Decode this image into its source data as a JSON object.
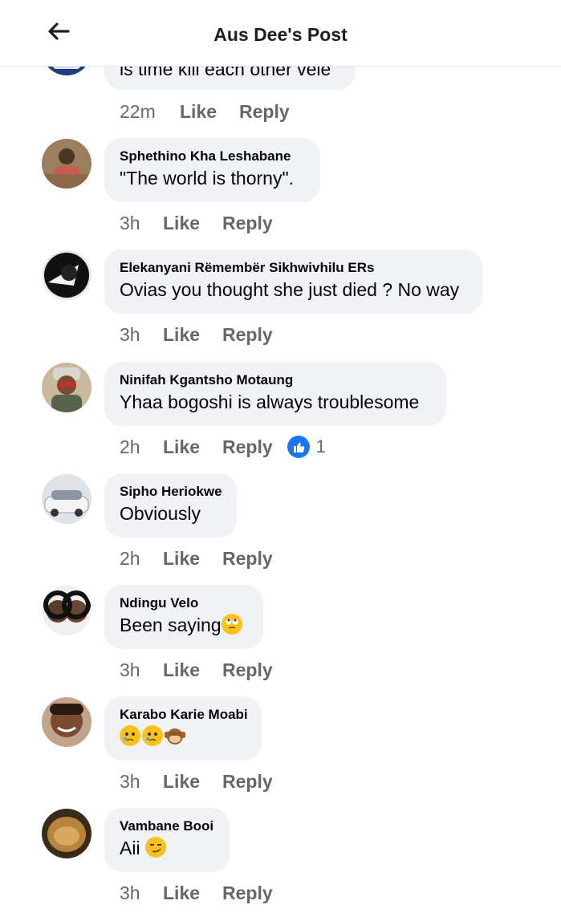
{
  "header": {
    "title": "Aus Dee's Post",
    "back_icon": "arrow-left-icon"
  },
  "partial_comment": {
    "text": "is time kill each other vele",
    "time": "22m",
    "like": "Like",
    "reply": "Reply"
  },
  "comments": [
    {
      "author": "Sphethino Kha Leshabane",
      "text": "\"The world is thorny\".",
      "time": "3h",
      "like": "Like",
      "reply": "Reply"
    },
    {
      "author": "Elekanyani Rëmembër Sikhwivhilu ERs",
      "text": "Ovias you thought she just died ? No way",
      "time": "3h",
      "like": "Like",
      "reply": "Reply"
    },
    {
      "author": "Ninifah Kgantsho Motaung",
      "text": "Yhaa bogoshi is always troublesome",
      "time": "2h",
      "like": "Like",
      "reply": "Reply",
      "reaction_count": "1"
    },
    {
      "author": "Sipho Heriokwe",
      "text": "Obviously",
      "time": "2h",
      "like": "Like",
      "reply": "Reply"
    },
    {
      "author": "Ndingu Velo",
      "text": "Been saying",
      "emoji": "face-with-rolling-eyes",
      "time": "3h",
      "like": "Like",
      "reply": "Reply"
    },
    {
      "author": "Karabo Karie Moabi",
      "text": "",
      "emoji": "crying-faces-and-monkey",
      "time": "3h",
      "like": "Like",
      "reply": "Reply"
    },
    {
      "author": "Vambane Booi",
      "text": "Aii",
      "emoji": "smirking-face",
      "time": "3h",
      "like": "Like",
      "reply": "Reply"
    }
  ],
  "colors": {
    "bubble": "#f0f2f5",
    "meta": "#65676b",
    "accent": "#1877f2"
  }
}
